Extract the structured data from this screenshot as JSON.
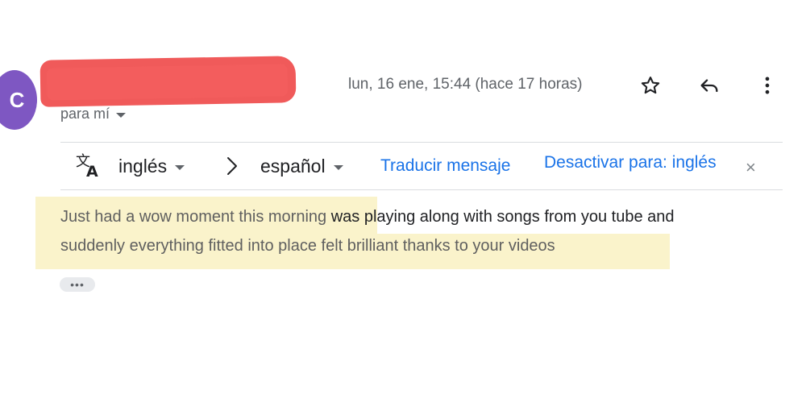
{
  "sender": {
    "avatar_letter": "C",
    "avatar_color": "#7e57c2",
    "redaction_color": "#f05a5a"
  },
  "header": {
    "recipient_label": "para mí",
    "timestamp": "lun, 16 ene, 15:44 (hace 17 horas)"
  },
  "actions": {
    "star_icon": "star-icon",
    "reply_icon": "reply-icon",
    "more_icon": "more-vert-icon"
  },
  "translation_bar": {
    "icon": "translate-icon",
    "source_language": "inglés",
    "target_language": "español",
    "translate_link": "Traducir mensaje",
    "disable_link": "Desactivar para: inglés",
    "close_glyph": "×"
  },
  "message": {
    "line1_highlighted": "Just had a wow moment this morning",
    "line1_rest": " was playing along with songs from you tube and",
    "line2": "suddenly everything fitted into place felt brilliant thanks to your videos",
    "highlight_color": "#faf3cb",
    "show_trimmed_label": "•••"
  },
  "colors": {
    "link": "#1a73e8",
    "muted": "#5f6368",
    "divider": "#dadce0"
  }
}
